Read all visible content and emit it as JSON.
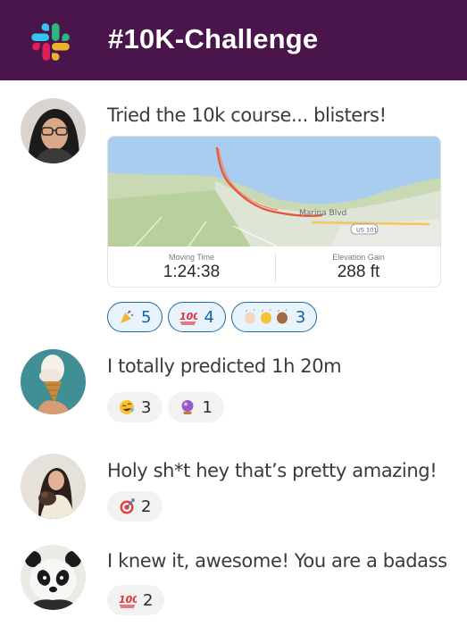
{
  "channel": {
    "title": "#10K-Challenge"
  },
  "colors": {
    "header_bg": "#4a154b",
    "reaction_active_border": "#1d6aa5",
    "reaction_active_bg": "#e8f3fb"
  },
  "messages": [
    {
      "text": "Tried the 10k course... blisters!",
      "avatar": "woman-glasses-avatar",
      "activity": {
        "map_street_label": "Marina Blvd",
        "map_road_badge": "US 101",
        "moving_time_label": "Moving Time",
        "moving_time": "1:24:38",
        "elevation_label": "Elevation Gain",
        "elevation": "288 ft"
      },
      "reactions": [
        {
          "emoji": "party-popper-icon",
          "count": "5"
        },
        {
          "emoji": "hundred-points-icon",
          "count": "4"
        },
        {
          "emoji": "clapping-hands-icon",
          "count": "3"
        }
      ]
    },
    {
      "text": "I totally predicted 1h 20m",
      "avatar": "ice-cream-avatar",
      "reactions": [
        {
          "emoji": "rolling-laughing-icon",
          "count": "3"
        },
        {
          "emoji": "crystal-ball-icon",
          "count": "1"
        }
      ]
    },
    {
      "text": "Holy sh*t hey that’s pretty amazing!",
      "avatar": "woman-dog-avatar",
      "reactions": [
        {
          "emoji": "direct-hit-icon",
          "count": "2"
        }
      ]
    },
    {
      "text": "I knew it, awesome! You are a badass",
      "avatar": "panda-avatar",
      "reactions": [
        {
          "emoji": "hundred-points-icon",
          "count": "2"
        }
      ]
    }
  ]
}
